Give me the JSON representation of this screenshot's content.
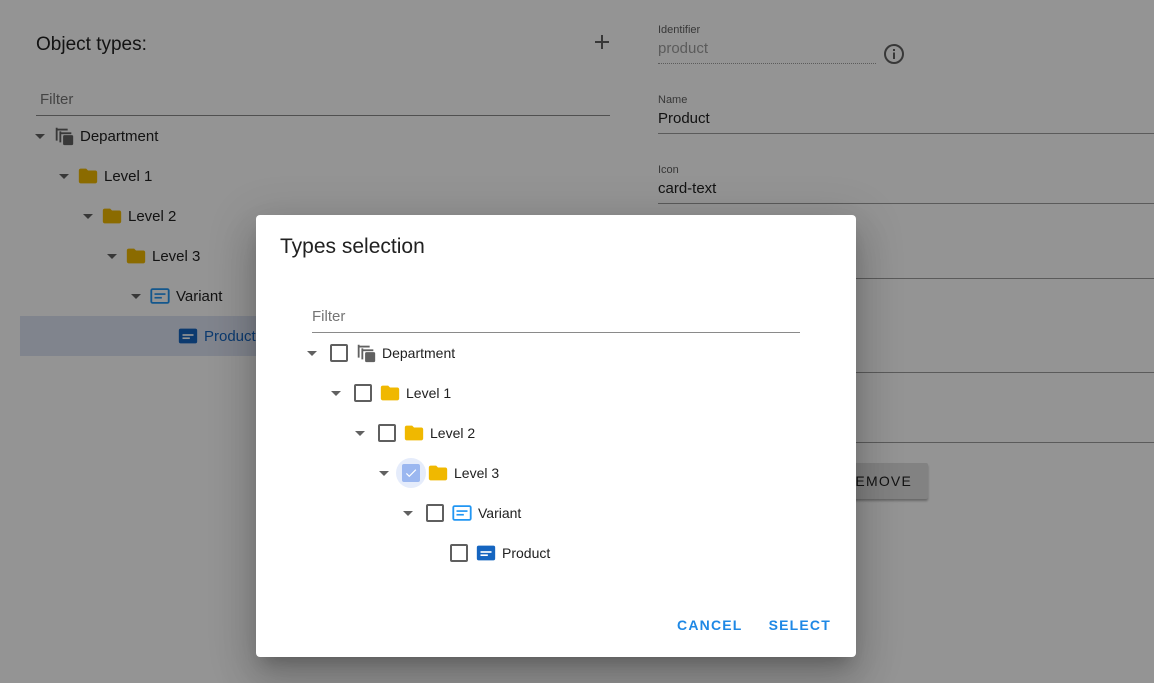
{
  "left": {
    "title": "Object types:",
    "filter_placeholder": "Filter",
    "tree": [
      {
        "label": "Department"
      },
      {
        "label": "Level 1"
      },
      {
        "label": "Level 2"
      },
      {
        "label": "Level 3"
      },
      {
        "label": "Variant"
      },
      {
        "label": "Product"
      }
    ]
  },
  "form": {
    "identifier": {
      "label": "Identifier",
      "value": "product"
    },
    "name": {
      "label": "Name",
      "value": "Product"
    },
    "icon": {
      "label": "Icon",
      "value": "card-text"
    },
    "remove_label": "REMOVE"
  },
  "dialog": {
    "title": "Types selection",
    "filter_placeholder": "Filter",
    "tree": [
      {
        "label": "Department",
        "checked": false
      },
      {
        "label": "Level 1",
        "checked": false
      },
      {
        "label": "Level 2",
        "checked": false
      },
      {
        "label": "Level 3",
        "checked": true
      },
      {
        "label": "Variant",
        "checked": false
      },
      {
        "label": "Product",
        "checked": false
      }
    ],
    "cancel_label": "CANCEL",
    "select_label": "SELECT"
  },
  "colors": {
    "folder": "#f0b800",
    "variant": "#2196f3",
    "product": "#1565c0",
    "department": "#616161",
    "accent": "#1e88e5",
    "selected_row": "#dde4f3"
  },
  "icons": {
    "department": "layers-icon",
    "level": "folder-icon",
    "variant": "card-outline-icon",
    "product": "card-text-icon"
  }
}
